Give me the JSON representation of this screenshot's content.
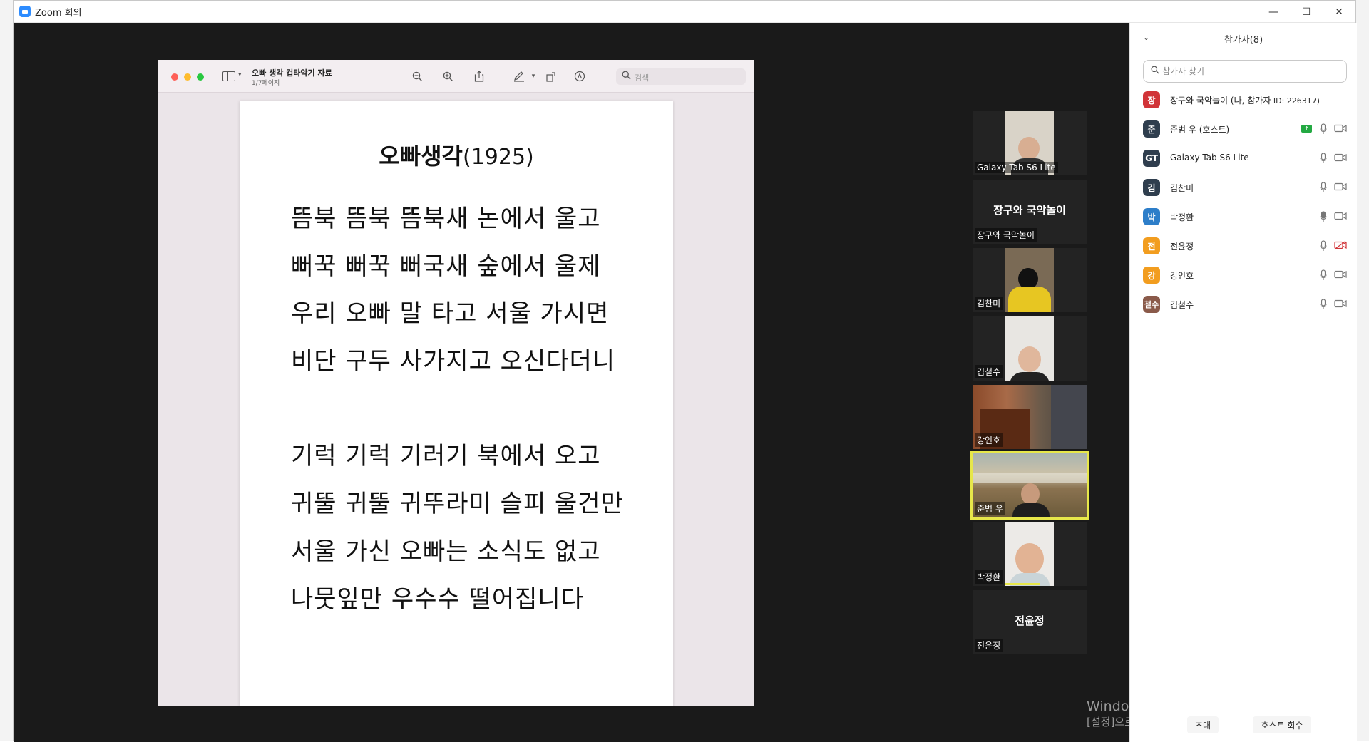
{
  "window": {
    "title": "Zoom 회의",
    "minimize": "—",
    "maximize": "☐",
    "close": "✕"
  },
  "preview": {
    "doc_title": "오빠 생각 컵타악기 자료",
    "doc_sub": "1/7페이지",
    "search_placeholder": "검색",
    "song_title": "오빠생각",
    "song_year": "(1925)",
    "lyrics": [
      "뜸북 뜸북 뜸북새 논에서  울고",
      "뻐꾹 뻐꾹 뻐국새 숲에서 울제",
      "우리 오빠 말 타고 서울 가시면",
      "비단 구두 사가지고 오신다더니",
      "기럭 기럭 기러기 북에서 오고",
      "귀뚤 귀뚤 귀뚜라미 슬피 울건만",
      "서울 가신 오빠는 소식도 없고",
      "나뭇잎만 우수수 떨어집니다"
    ]
  },
  "gallery": [
    {
      "name": "Galaxy Tab S6 Lite",
      "type": "camera"
    },
    {
      "name": "장구와 국악놀이",
      "center": "장구와 국악놀이",
      "type": "nocam"
    },
    {
      "name": "김찬미",
      "type": "camera"
    },
    {
      "name": "김철수",
      "type": "camera"
    },
    {
      "name": "강인호",
      "type": "camera"
    },
    {
      "name": "준범 우",
      "type": "camera",
      "active": true
    },
    {
      "name": "박정환",
      "type": "camera"
    },
    {
      "name": "전윤정",
      "center": "전윤정",
      "type": "nocam"
    }
  ],
  "panel": {
    "title": "참가자(8)",
    "collapse_icon": "⌄",
    "search_placeholder": "참가자 찾기",
    "participants": [
      {
        "avatar": "장",
        "color": "#d13438",
        "name": "장구와 국악놀이 (나, 참가자",
        "sub": " ID: 226317)",
        "mic": false,
        "cam": false
      },
      {
        "avatar": "준",
        "color": "#2f3e4e",
        "name": "준범 우 (호스트)",
        "sub": "",
        "share": true,
        "mic": true,
        "cam": true
      },
      {
        "avatar": "GT",
        "color": "#2f3e4e",
        "name": "Galaxy Tab S6 Lite",
        "sub": "",
        "mic": true,
        "cam": true
      },
      {
        "avatar": "김",
        "color": "#2f3e4e",
        "name": "김찬미",
        "sub": "",
        "mic": true,
        "cam": true
      },
      {
        "avatar": "박",
        "color": "#2d7ec9",
        "name": "박정환",
        "sub": "",
        "mic": true,
        "cam": true
      },
      {
        "avatar": "전",
        "color": "#f29d1f",
        "name": "전윤정",
        "sub": "",
        "mic": true,
        "cam": "off"
      },
      {
        "avatar": "강",
        "color": "#f29d1f",
        "name": "강인호",
        "sub": "",
        "mic": true,
        "cam": true
      },
      {
        "avatar": "철수",
        "color": "#8a5a4a",
        "name": "김철수",
        "sub": "",
        "mic": true,
        "cam": true
      }
    ],
    "invite_label": "초대",
    "reclaim_label": "호스트 회수"
  },
  "watermark": {
    "line1": "Windows 정품 인증",
    "line2": "[설정]으로 이동하여 Windows를 정품 인증합니다."
  },
  "colors": {
    "active_speaker": "#e7e74a",
    "share_green": "#23a942",
    "cam_off_red": "#d13438"
  }
}
